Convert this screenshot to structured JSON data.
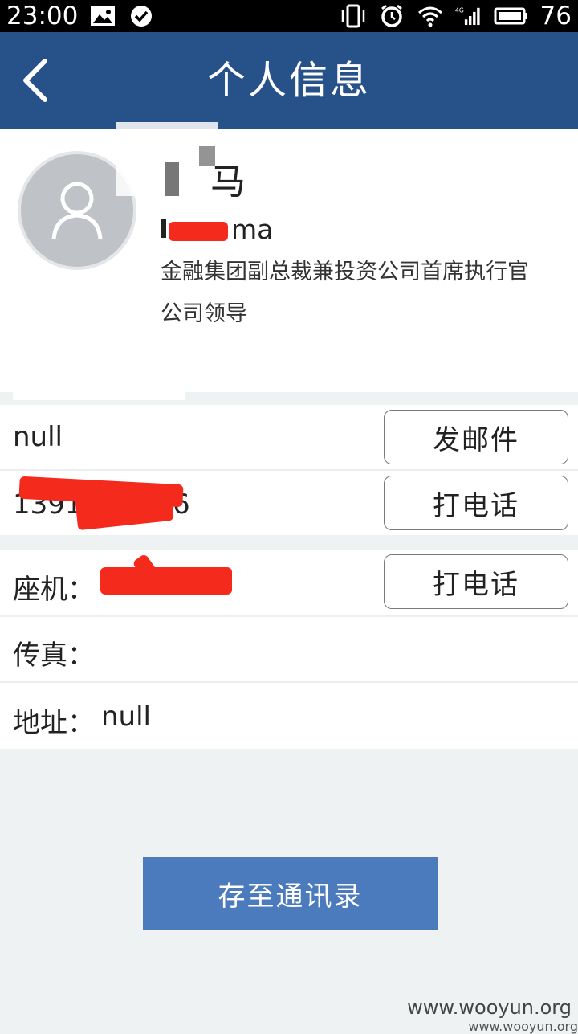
{
  "status_bar": {
    "time": "23:00",
    "battery": "76",
    "network_type": "4G",
    "icons": [
      "image-icon",
      "check-circle-icon",
      "vibrate-icon",
      "alarm-icon",
      "wifi-icon",
      "signal-icon",
      "battery-icon"
    ]
  },
  "header": {
    "title": "个人信息",
    "back_icon": "chevron-left-icon"
  },
  "profile": {
    "name": "马",
    "username": "ma",
    "title": "金融集团副总裁兼投资公司首席执行官",
    "department": "公司领导"
  },
  "contact": {
    "email": "null",
    "email_button": "发邮件",
    "mobile": "1391",
    "mobile_suffix": "6",
    "mobile_button": "打电话",
    "landline_label": "座机：",
    "landline_button": "打电话",
    "fax_label": "传真：",
    "address_label": "地址：",
    "address_value": "null"
  },
  "save_button": "存至通讯录",
  "watermark": "www.wooyun.org",
  "watermark_small": "www.wooyun.org",
  "colors": {
    "header_bg": "#275189",
    "save_button_bg": "#4c7bbd",
    "redaction": "#f42a1c"
  }
}
